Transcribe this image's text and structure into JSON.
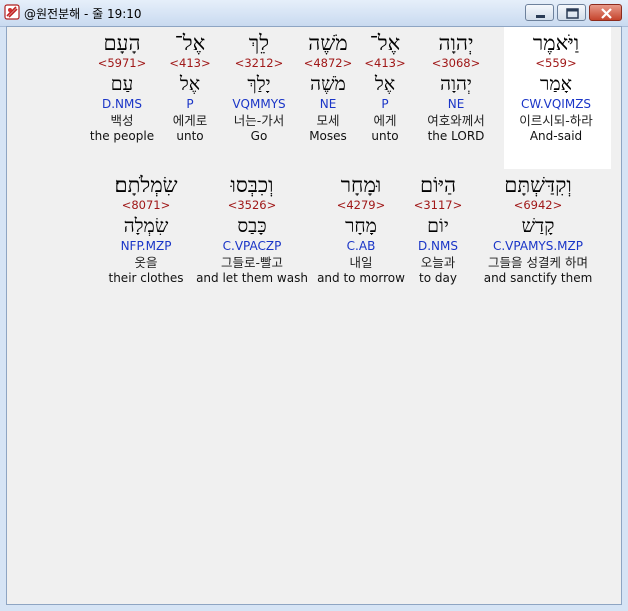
{
  "window": {
    "title": "@원전분해 - 줄 19:10",
    "icon": "app-logo-icon",
    "controls": [
      "minimize-icon",
      "maximize-icon",
      "close-icon"
    ]
  },
  "rows": [
    {
      "words": [
        {
          "hebrew": "הָעָם",
          "strongs": "<5971>",
          "lemma": "עַם",
          "parse": "D.NMS",
          "korean": "백성",
          "english": "the people"
        },
        {
          "hebrew": "אֶל־",
          "strongs": "<413>",
          "lemma": "אֶל",
          "parse": "P",
          "korean": "에게로",
          "english": "unto"
        },
        {
          "hebrew": "לֵךְ",
          "strongs": "<3212>",
          "lemma": "יָלַךְ",
          "parse": "VQMMYS",
          "korean": "너는-가서",
          "english": "Go"
        },
        {
          "hebrew": "מֹשֶׁה",
          "strongs": "<4872>",
          "lemma": "מֹשֶׁה",
          "parse": "NE",
          "korean": "모세",
          "english": "Moses"
        },
        {
          "hebrew": "אֶל־",
          "strongs": "<413>",
          "lemma": "אֶל",
          "parse": "P",
          "korean": "에게",
          "english": "unto"
        },
        {
          "hebrew": "יְהוָה",
          "strongs": "<3068>",
          "lemma": "יְהוָה",
          "parse": "NE",
          "korean": "여호와께서",
          "english": "the LORD"
        },
        {
          "hebrew": "וַיֹּאמֶר",
          "strongs": "<559>",
          "lemma": "אָמַר",
          "parse": "CW.VQIMZS",
          "korean": "이르시되-하라",
          "english": "And-said",
          "selected": true
        }
      ]
    },
    {
      "words": [
        {
          "hebrew": "שִׂמְלֹתָם׃",
          "strongs": "<8071>",
          "lemma": "שִׂמְלָה",
          "parse": "NFP.MZP",
          "korean": "옷을",
          "english": "their clothes"
        },
        {
          "hebrew": "וְכִבְּסוּ",
          "strongs": "<3526>",
          "lemma": "כָּבַס",
          "parse": "C.VPACZP",
          "korean": "그들로-빨고",
          "english": "and let them wash"
        },
        {
          "hebrew": "וּמָחָר",
          "strongs": "<4279>",
          "lemma": "מָחָר",
          "parse": "C.AB",
          "korean": "내일",
          "english": "and to morrow"
        },
        {
          "hebrew": "הַיּוֹם",
          "strongs": "<3117>",
          "lemma": "יוֹם",
          "parse": "D.NMS",
          "korean": "오늘과",
          "english": "to day"
        },
        {
          "hebrew": "וְקִדַּשְׁתָּם",
          "strongs": "<6942>",
          "lemma": "קָדַשׁ",
          "parse": "C.VPAMYS.MZP",
          "korean": "그들을 성결케 하며",
          "english": "and sanctify them"
        }
      ]
    }
  ]
}
